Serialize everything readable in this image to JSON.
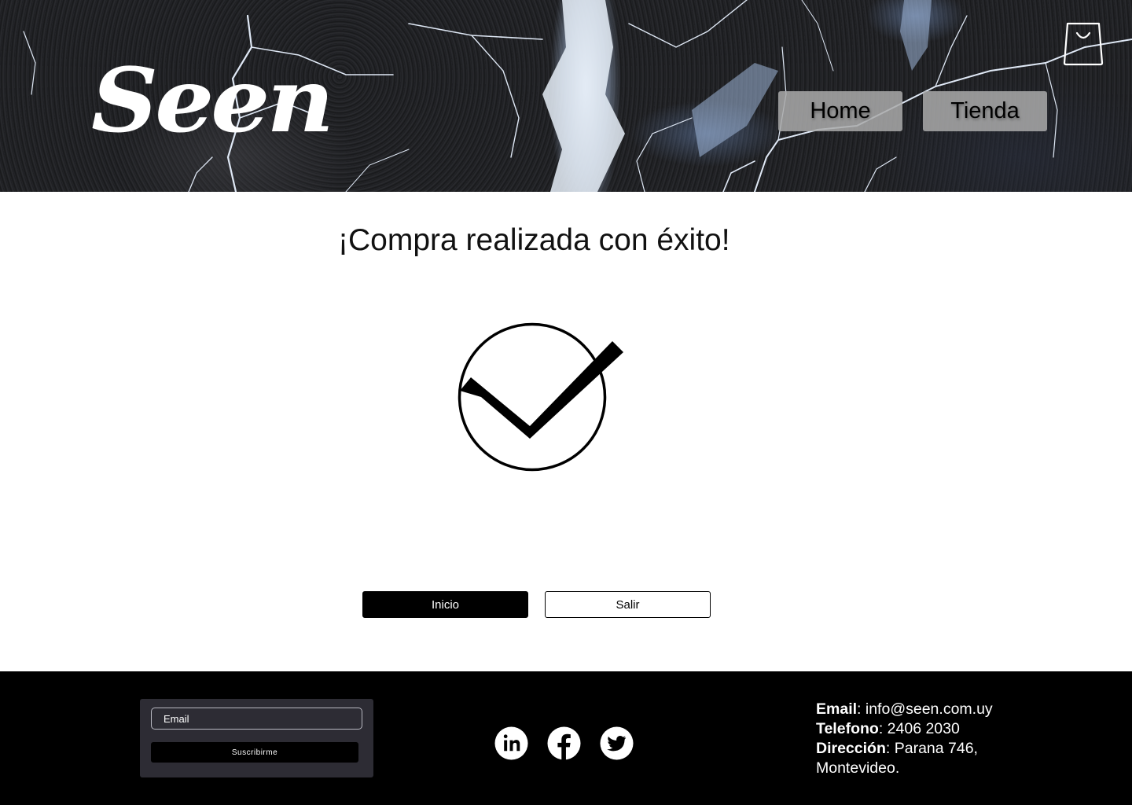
{
  "header": {
    "logo_text": "Seen",
    "nav": [
      {
        "label": "Home"
      },
      {
        "label": "Tienda"
      }
    ],
    "cart_icon": "shopping-bag-icon"
  },
  "main": {
    "title": "¡Compra realizada con éxito!",
    "status_icon": "check-circle-icon",
    "buttons": {
      "inicio": "Inicio",
      "salir": "Salir"
    }
  },
  "footer": {
    "newsletter": {
      "email_placeholder": "Email",
      "email_value": "",
      "subscribe_label": "Suscribirme"
    },
    "social": [
      {
        "icon": "linkedin-icon"
      },
      {
        "icon": "facebook-icon"
      },
      {
        "icon": "twitter-icon"
      }
    ],
    "contact": {
      "email_label": "Email",
      "email_value": "info@seen.com.uy",
      "phone_label": "Telefono",
      "phone_value": "2406 2030",
      "address_label": "Dirección",
      "address_value": "Parana 746, Montevideo."
    }
  },
  "colors": {
    "primary": "#000000",
    "background": "#ffffff",
    "nav_button": "#aaaaaa",
    "newsletter_panel": "#2d2c34"
  }
}
